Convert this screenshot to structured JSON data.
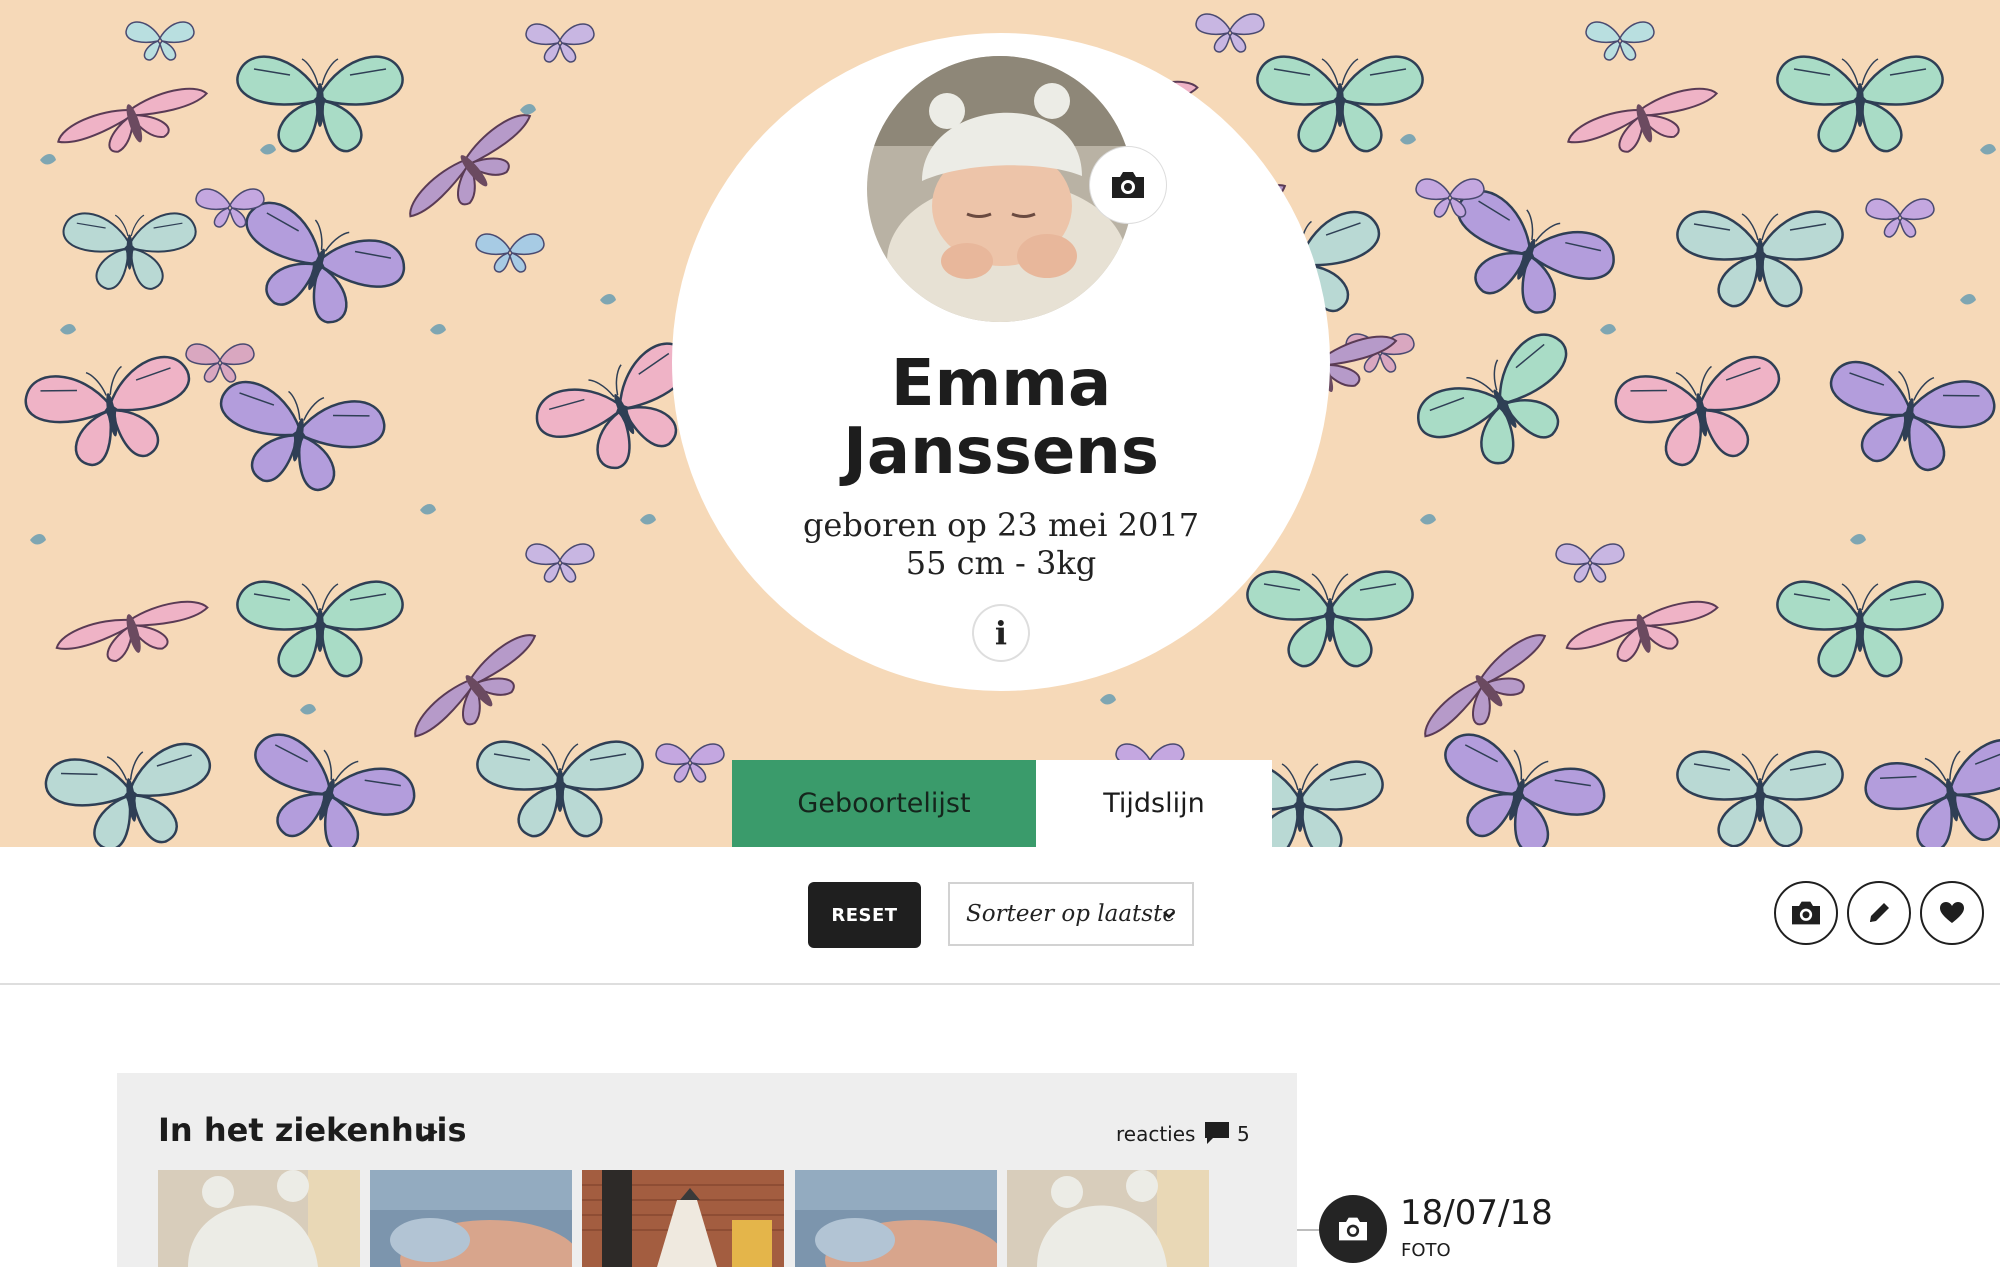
{
  "profile": {
    "name_line1": "Emma",
    "name_line2": "Janssens",
    "birth_date": "geboren op 23 mei 2017",
    "measurements": "55 cm - 3kg",
    "info_label": "i"
  },
  "tabs": [
    {
      "label": "Geboortelijst",
      "active": true
    },
    {
      "label": "Tijdslijn",
      "active": false
    }
  ],
  "toolbar": {
    "reset_label": "RESET",
    "sort_selected": "Sorteer op laatste",
    "actions": [
      "camera-icon",
      "pencil-icon",
      "heart-icon"
    ]
  },
  "post": {
    "title": "In het ziekenhuis",
    "chevron": ">",
    "reactions_label": "reacties",
    "reactions_count": "5",
    "thumbnails": [
      "baby-in-hat",
      "sleeping-baby",
      "nursery-room",
      "sleeping-baby",
      "baby-in-hat"
    ]
  },
  "timeline": {
    "date": "18/07/18",
    "type": "FOTO"
  },
  "colors": {
    "hero_background": "#f6d9b8",
    "accent_green": "#3a9b6b",
    "dark": "#1f1f1f",
    "card_background": "#eeeeee"
  }
}
